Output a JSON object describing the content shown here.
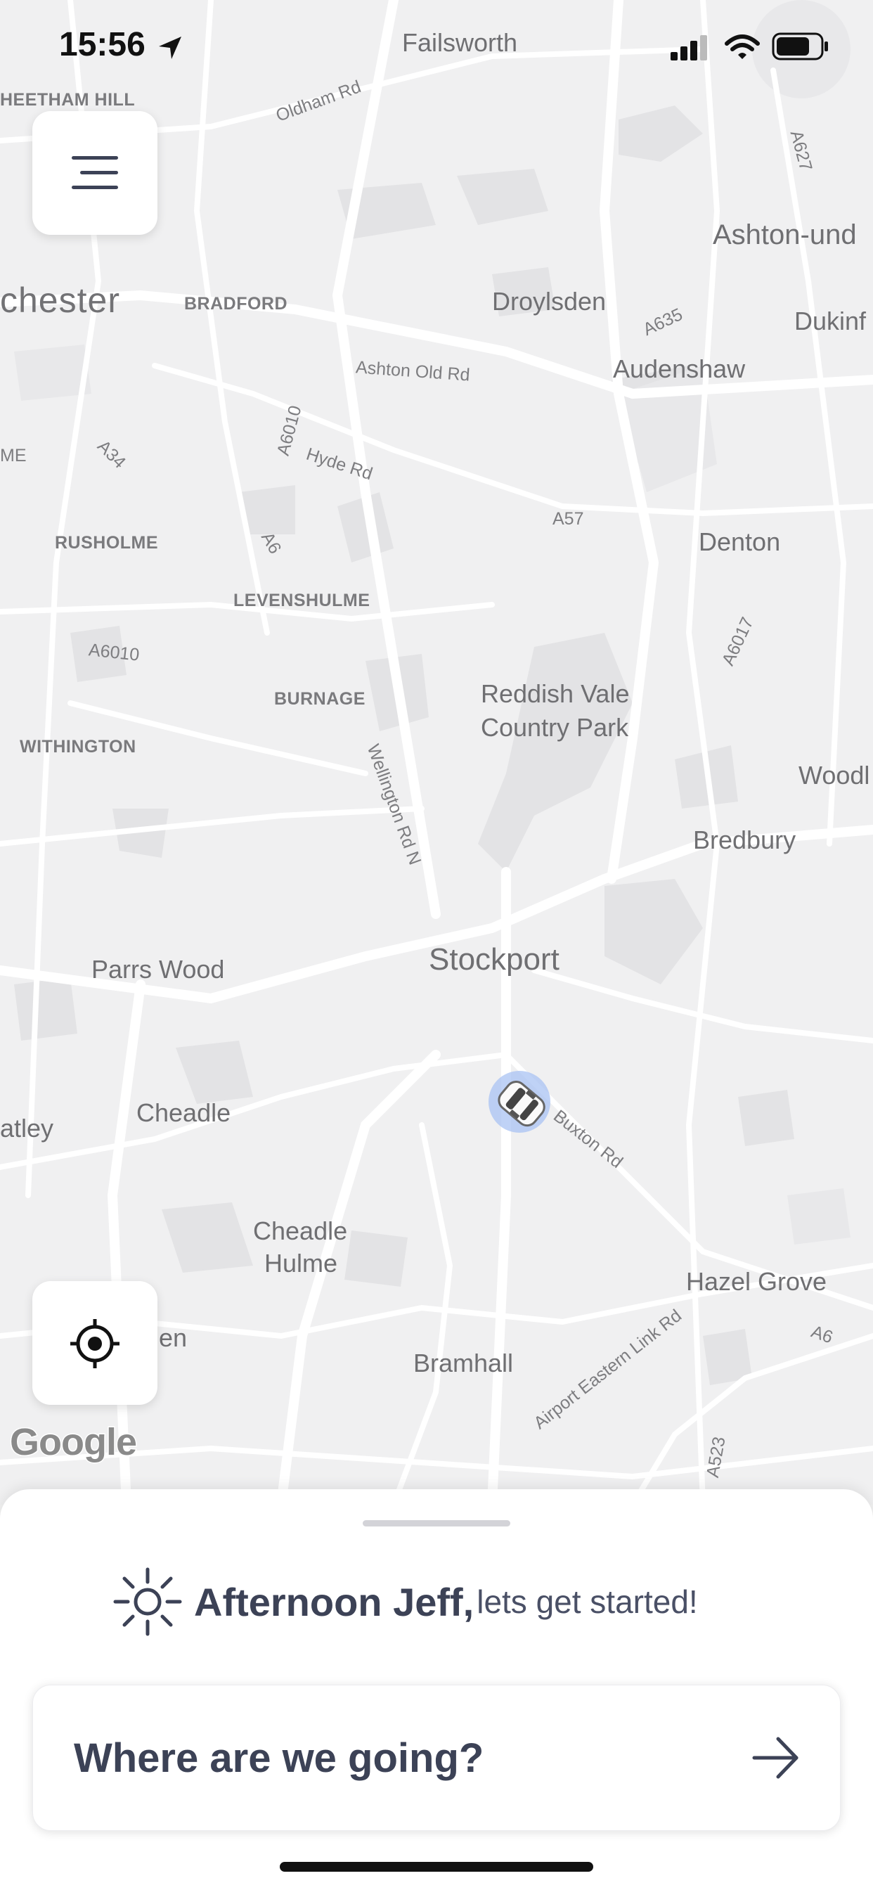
{
  "status_bar": {
    "time": "15:56"
  },
  "map": {
    "labels": {
      "failsworth": "Failsworth",
      "cheetham_hill": "HEETHAM HILL",
      "oldham_rd": "Oldham Rd",
      "a627": "A627",
      "ashton": "Ashton-und",
      "manchester": "chester",
      "bradford": "BRADFORD",
      "droylsden": "Droylsden",
      "a635": "A635",
      "dukinf": "Dukinf",
      "ashton_old_rd": "Ashton Old Rd",
      "audenshaw": "Audenshaw",
      "a6010_top": "A6010",
      "me": "ME",
      "a34": "A34",
      "hyde_rd": "Hyde Rd",
      "a57": "A57",
      "denton": "Denton",
      "rusholme": "RUSHOLME",
      "a6": "A6",
      "levenshulme": "LEVENSHULME",
      "a6017": "A6017",
      "a6010_mid": "A6010",
      "burnage": "BURNAGE",
      "reddish_vale_1": "Reddish Vale",
      "reddish_vale_2": "Country Park",
      "withington": "WITHINGTON",
      "woodl": "Woodl",
      "wellington_rd": "Wellington Rd N",
      "bredbury": "Bredbury",
      "parrs_wood": "Parrs Wood",
      "stockport": "Stockport",
      "atley": "atley",
      "cheadle": "Cheadle",
      "buxton_rd": "Buxton Rd",
      "cheadle_hulme_1": "Cheadle",
      "cheadle_hulme_2": "Hulme",
      "hazel_grove": "Hazel Grove",
      "en": "en",
      "a6_south": "A6",
      "bramhall": "Bramhall",
      "airport_link": "Airport Eastern Link Rd",
      "a523": "A523"
    },
    "attribution": "Google"
  },
  "sheet": {
    "greeting_name": "Afternoon Jeff,",
    "greeting_rest": "lets get started!",
    "search_prompt": "Where are we going?"
  },
  "colors": {
    "text_dark": "#3c4256",
    "map_bg": "#f0f0f1",
    "road": "#ffffff",
    "park": "#e2e2e4",
    "location_halo": "#a9c3f3"
  },
  "icons": {
    "menu": "hamburger-icon",
    "locate": "crosshair-icon",
    "greeting": "sun-icon",
    "go": "arrow-right-icon",
    "vehicle": "car-icon"
  }
}
